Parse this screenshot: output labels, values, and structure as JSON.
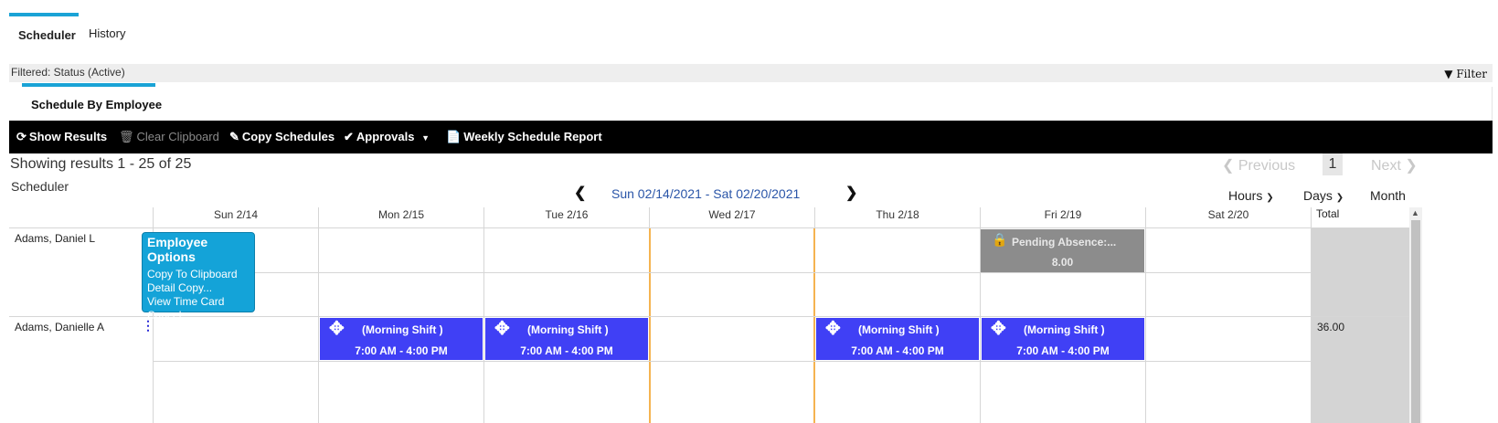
{
  "tabs": [
    {
      "label": "Scheduler",
      "active": true
    },
    {
      "label": "History",
      "active": false
    }
  ],
  "filter_bar": {
    "text": "Filtered: Status (Active)",
    "filter_button": "Filter"
  },
  "section": {
    "title": "Schedule By Employee"
  },
  "toolbar": {
    "show_results": "Show Results",
    "clear_clipboard": "Clear Clipboard",
    "copy_schedules": "Copy Schedules",
    "approvals": "Approvals",
    "weekly_report": "Weekly Schedule Report"
  },
  "results": {
    "summary": "Showing results 1 - 25 of 25",
    "label": "Scheduler"
  },
  "pager": {
    "previous": "Previous",
    "page": "1",
    "next": "Next"
  },
  "date_range": "Sun 02/14/2021 - Sat 02/20/2021",
  "views": {
    "hours": "Hours",
    "days": "Days",
    "month": "Month"
  },
  "columns": [
    "Sun 2/14",
    "Mon 2/15",
    "Tue 2/16",
    "Wed 2/17",
    "Thu 2/18",
    "Fri 2/19",
    "Sat 2/20"
  ],
  "total_header": "Total",
  "employees": [
    {
      "name": "Adams, Daniel L",
      "total": ""
    },
    {
      "name": "Adams, Danielle A",
      "total": "36.00"
    }
  ],
  "absence": {
    "label": "Pending Absence:...",
    "hours": "8.00"
  },
  "shift": {
    "name": "(Morning Shift )",
    "time": "7:00 AM - 4:00 PM"
  },
  "popup": {
    "title": "Employee Options",
    "items": [
      "Copy To Clipboard",
      "Detail Copy...",
      "View Time Card",
      "Cancel"
    ]
  },
  "colors": {
    "accent": "#1aa3d6",
    "shift": "#4040f5",
    "absence": "#8c8c8c",
    "today_line": "#f5b350"
  }
}
